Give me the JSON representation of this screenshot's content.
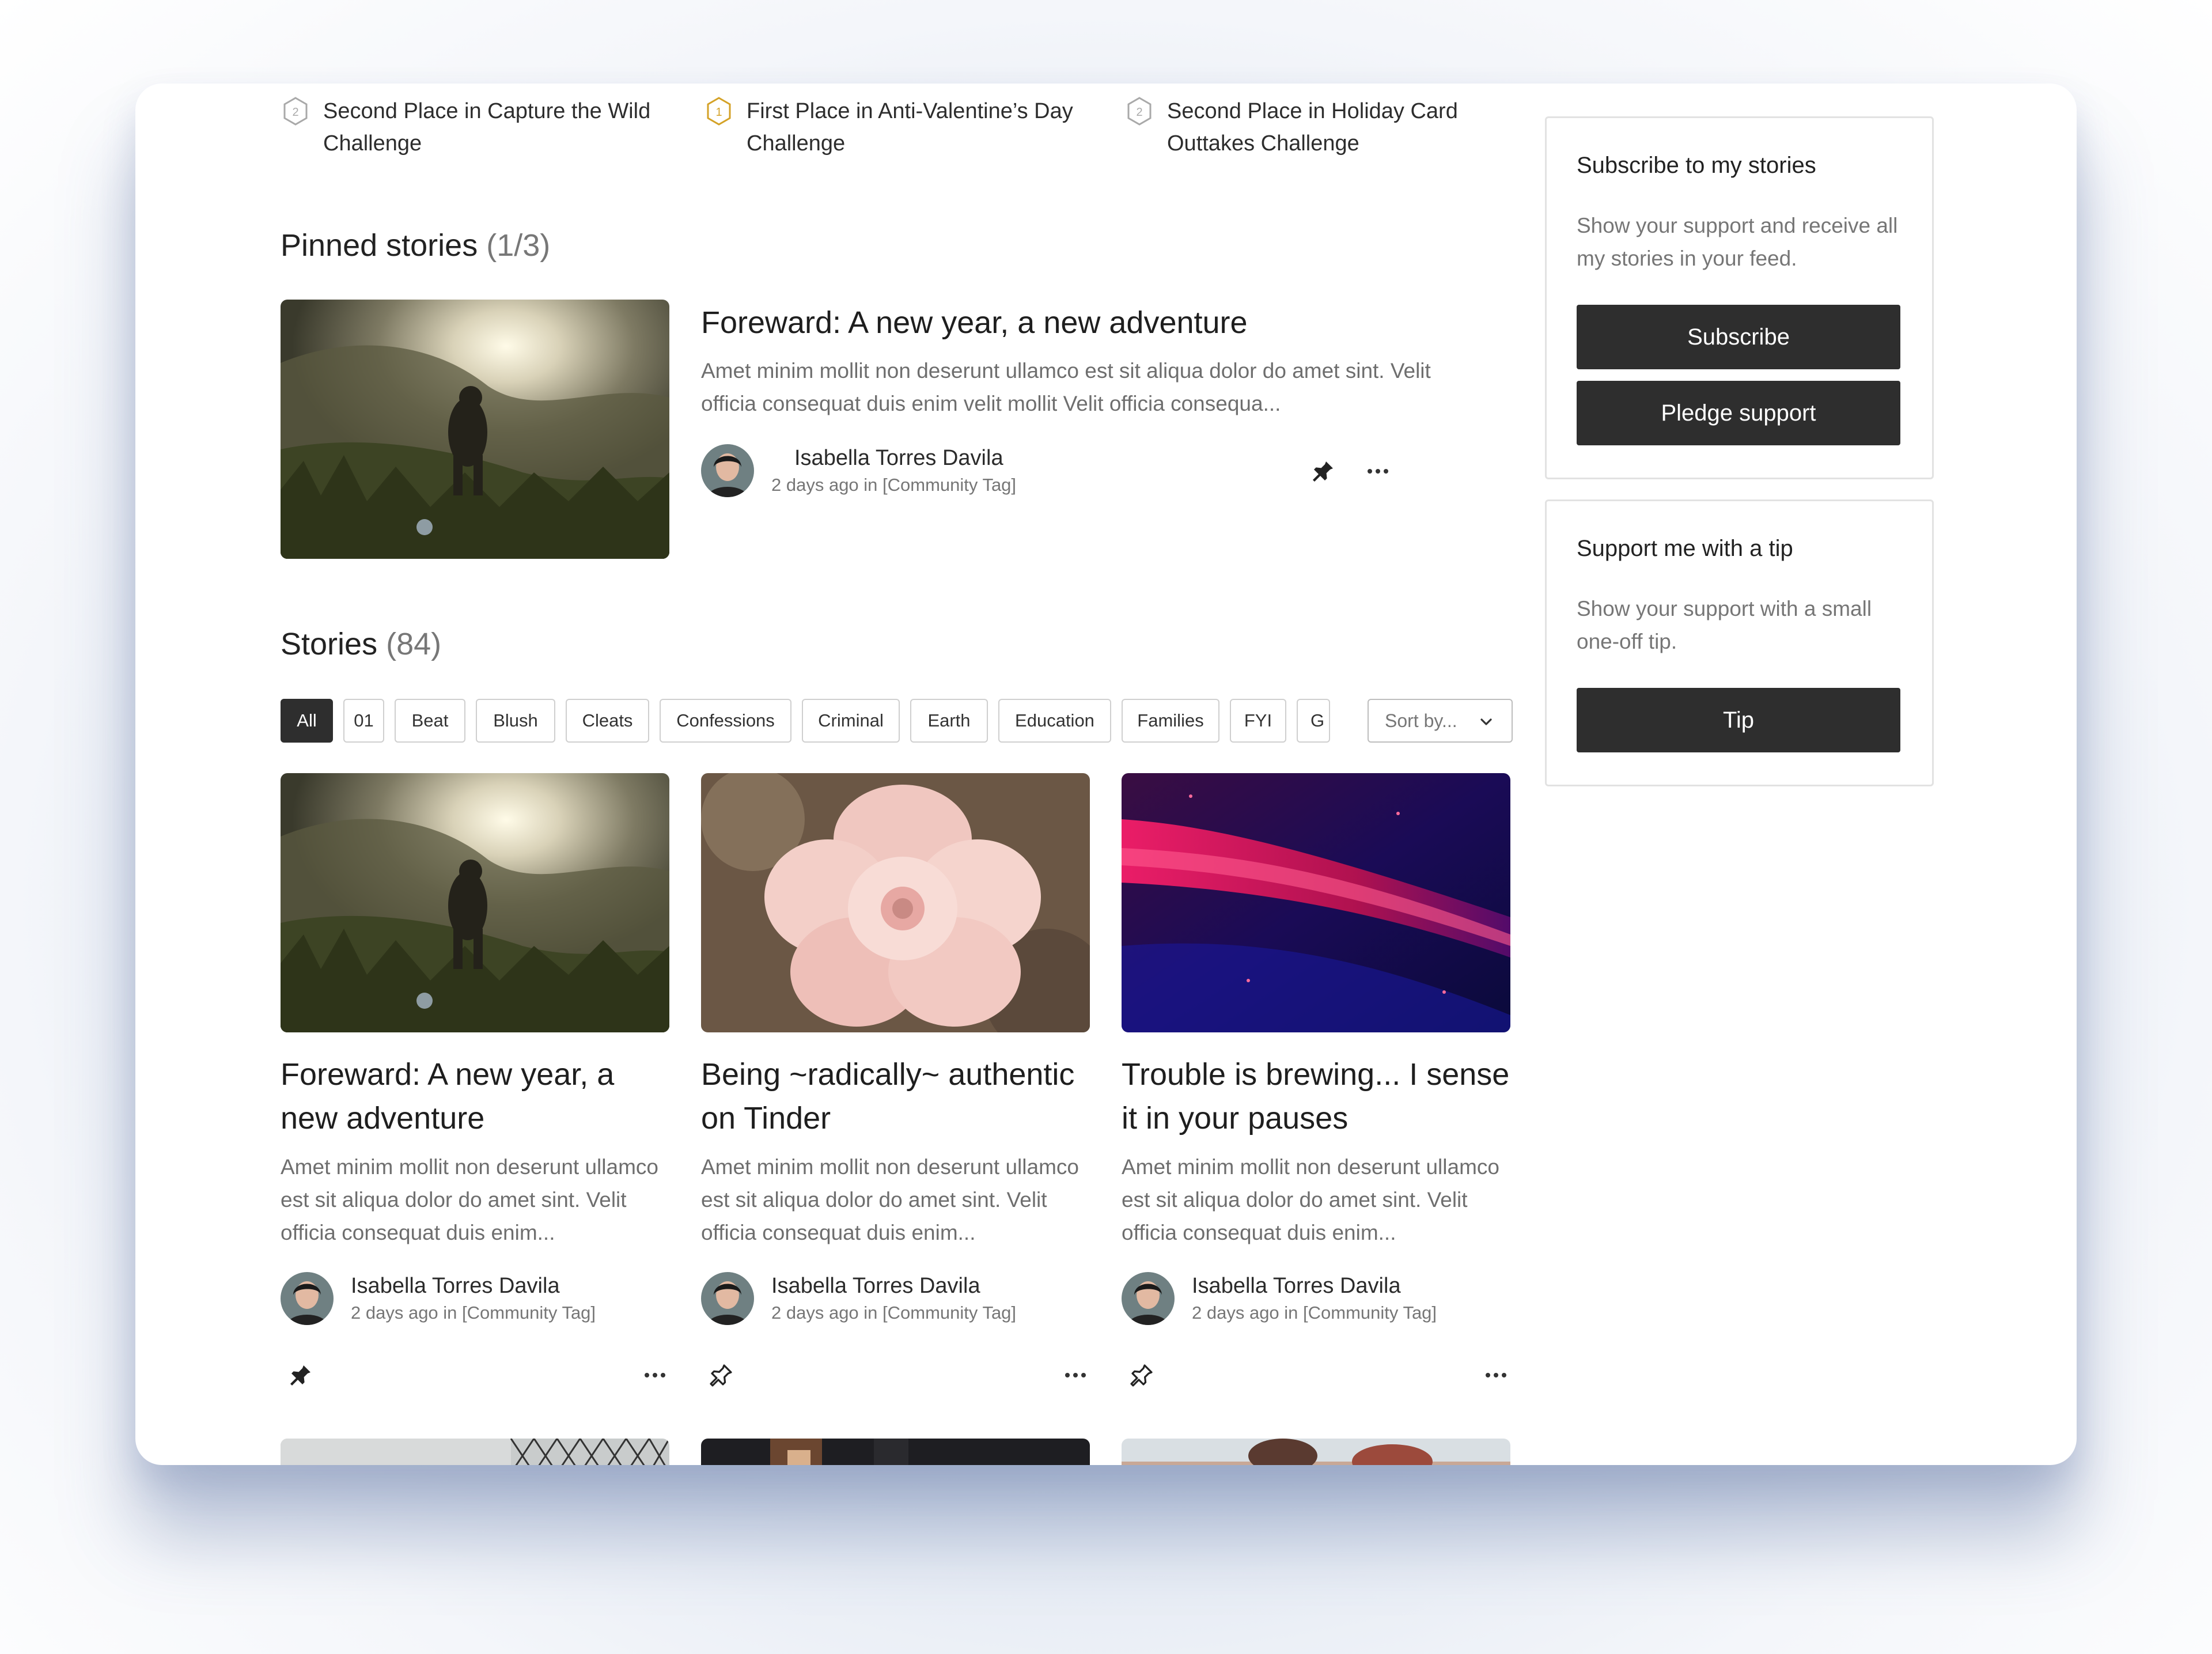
{
  "awards": [
    {
      "place": "2",
      "label": "Second Place in Capture the Wild Challenge",
      "color": "#a9a9a9"
    },
    {
      "place": "1",
      "label": "First Place in Anti-Valentine’s Day Challenge",
      "color": "#d4a227"
    },
    {
      "place": "2",
      "label": "Second Place in Holiday Card Outtakes Challenge",
      "color": "#a9a9a9"
    }
  ],
  "pinned": {
    "heading": "Pinned stories",
    "count": "(1/3)",
    "story": {
      "title": "Foreward: A new year, a new adventure",
      "excerpt": "Amet minim mollit non deserunt ullamco est sit aliqua dolor do amet sint. Velit officia consequat duis enim velit mollit Velit officia consequa...",
      "author": "Isabella Torres Davila",
      "meta": "2 days ago in [Community Tag]"
    }
  },
  "stories": {
    "heading": "Stories",
    "count": "(84)",
    "filters": [
      "All",
      "01",
      "Beat",
      "Blush",
      "Cleats",
      "Confessions",
      "Criminal",
      "Earth",
      "Education",
      "Families",
      "FYI",
      "G"
    ],
    "active_filter": "All",
    "sort_label": "Sort by...",
    "cards": [
      {
        "title": "Foreward: A new year, a new adventure",
        "excerpt": "Amet minim mollit non deserunt ullamco est sit aliqua dolor do amet sint. Velit officia consequat duis enim...",
        "author": "Isabella Torres Davila",
        "meta": "2 days ago in [Community Tag]",
        "pinned": true
      },
      {
        "title": "Being ~radically~ authentic on Tinder",
        "excerpt": "Amet minim mollit non deserunt ullamco est sit aliqua dolor do amet sint. Velit officia consequat duis enim...",
        "author": "Isabella Torres Davila",
        "meta": "2 days ago in [Community Tag]",
        "pinned": false
      },
      {
        "title": "Trouble is brewing... I sense it in your pauses",
        "excerpt": "Amet minim mollit non deserunt ullamco est sit aliqua dolor do amet sint. Velit officia consequat duis enim...",
        "author": "Isabella Torres Davila",
        "meta": "2 days ago in [Community Tag]",
        "pinned": false
      }
    ]
  },
  "sidebar": {
    "subscribe": {
      "title": "Subscribe to my stories",
      "text": "Show your support and receive all my stories in your feed.",
      "subscribe_label": "Subscribe",
      "pledge_label": "Pledge support"
    },
    "tip": {
      "title": "Support me with a tip",
      "text": "Show your support with a small one-off tip.",
      "tip_label": "Tip"
    }
  },
  "colors": {
    "button_bg": "#2e2e2e",
    "gold_badge": "#d4a227",
    "silver_badge": "#a9a9a9"
  }
}
